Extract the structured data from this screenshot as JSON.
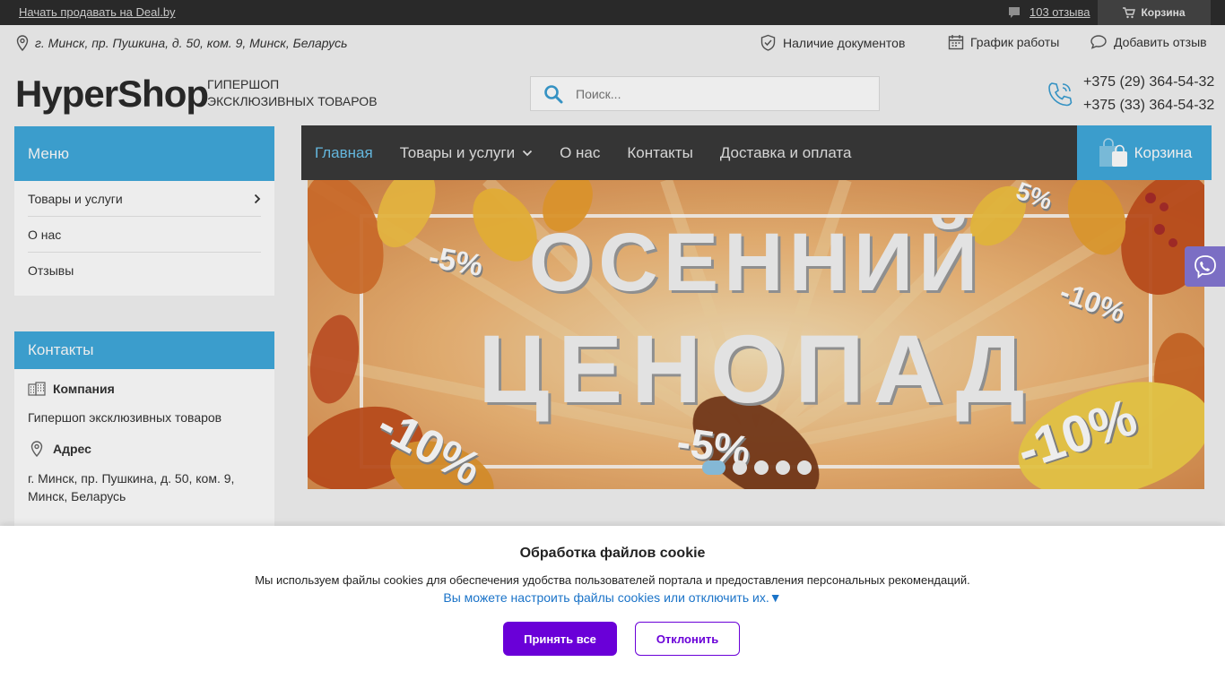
{
  "topbar": {
    "sell_link": "Начать продавать на Deal.by",
    "reviews_link": "103 отзыва",
    "cart_label": "Корзина"
  },
  "infobar": {
    "address": "г. Минск, пр. Пушкина, д. 50, ком. 9, Минск, Беларусь",
    "documents": "Наличие документов",
    "schedule": "График работы",
    "add_review": "Добавить отзыв"
  },
  "header": {
    "logo": "HyperShop",
    "slogan_line1": "ГИПЕРШОП",
    "slogan_line2": "ЭКСКЛЮЗИВНЫХ ТОВАРОВ",
    "search_placeholder": "Поиск...",
    "phone1": "+375 (29) 364-54-32",
    "phone2": "+375 (33) 364-54-32"
  },
  "sidebar": {
    "menu_title": "Меню",
    "menu_items": [
      {
        "label": "Товары и услуги"
      },
      {
        "label": "О нас"
      },
      {
        "label": "Отзывы"
      }
    ],
    "contacts_title": "Контакты",
    "company_title": "Компания",
    "company_name": "Гипершоп эксклюзивных товаров",
    "address_title": "Адрес",
    "address_line1": "г. Минск, пр. Пушкина, д. 50, ком. 9,",
    "address_line2": "Минск, Беларусь"
  },
  "nav": {
    "items": [
      {
        "label": "Главная"
      },
      {
        "label": "Товары и услуги"
      },
      {
        "label": "О нас"
      },
      {
        "label": "Контакты"
      },
      {
        "label": "Доставка и оплата"
      }
    ],
    "cart_label": "Корзина"
  },
  "banner": {
    "line1": "ОСЕННИЙ",
    "line2": "ЦЕНОПАД",
    "discounts": [
      "-5%",
      "-10%",
      "-10%",
      "-5%",
      "-10%",
      "5%"
    ],
    "slides": 5,
    "active_slide": 1
  },
  "cookie": {
    "title": "Обработка файлов cookie",
    "description": "Мы используем файлы cookies для обеспечения удобства пользователей портала и предоставления персональных рекомендаций.",
    "settings_link": "Вы можете настроить файлы cookies или отключить их.▼",
    "accept_label": "Принять все",
    "decline_label": "Отклонить"
  },
  "colors": {
    "accent": "#40a9dc",
    "nav_bg": "#3a3a3a",
    "cookie_button": "#6a00d8",
    "viber": "#7b6ec4"
  },
  "icons": [
    "location-icon",
    "shield-check-icon",
    "calendar-icon",
    "chat-icon",
    "search-icon",
    "phone-icon",
    "chevron-right-icon",
    "chevron-down-icon",
    "building-icon",
    "shopping-bag-icon",
    "cart-icon",
    "viber-icon",
    "comment-icon"
  ]
}
